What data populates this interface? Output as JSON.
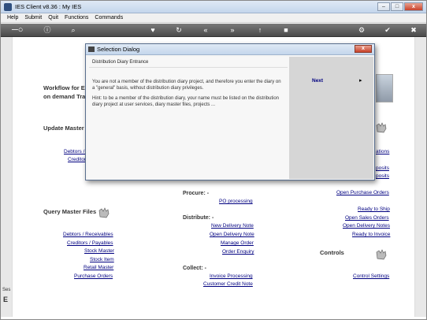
{
  "window": {
    "title": "IES Client v8.36 : My IES",
    "min": "–",
    "max": "□",
    "close": "x"
  },
  "menu": [
    "Help",
    "Submit",
    "Quit",
    "Functions",
    "Commands"
  ],
  "toolbar": {
    "icons": [
      "key-icon",
      "help-icon",
      "search-icon",
      "heart-icon",
      "refresh-icon",
      "back-icon",
      "forward-icon",
      "up-icon",
      "stop-icon",
      "settings-icon",
      "ok-icon",
      "close-icon"
    ]
  },
  "main": {
    "workflow_line1": "Workflow for Exp",
    "workflow_line2": "on demand Trad",
    "update_master": "Update Master Fi",
    "debtors_partial": "Debtors / I",
    "creditors_partial": "Creditor",
    "right_links_top": [
      "ations",
      "posits",
      "posits"
    ],
    "procure": "Procure: -",
    "po_processing": "PO processing",
    "open_purchase_orders": "Open Purchase Orders",
    "query_master": "Query Master Files",
    "distribute": "Distribute: -",
    "ready_to_ship": "Ready to Ship",
    "open_sales_orders": "Open Sales Orders",
    "open_delivery_notes": "Open Delivery Notes",
    "ready_to_invoice": "Ready to Invoice",
    "new_delivery_note": "New Delivery Note",
    "open_delivery_note": "Open Delivery Note",
    "manage_order": "Manage Order",
    "order_enquiry": "Order Enquiry",
    "controls": "Controls",
    "query_links": [
      "Debtors / Receivables",
      "Creditors / Payables",
      "Stock Master",
      "Stock Item",
      "Retail Master",
      "Purchase Orders"
    ],
    "collect": "Collect: -",
    "invoice_processing": "Invoice Processing",
    "customer_credit_note": "Customer Credit Note",
    "control_settings": "Control Settings",
    "bottom_left_1": "Ses",
    "bottom_left_2": "E"
  },
  "dialog": {
    "title": "Selection Dialog",
    "close": "x",
    "heading": "Distribution Diary Entrance",
    "para1": "You are not a member of the distribution diary project, and therefore you enter the diary on a \"general\" basis, without distribution diary privileges.",
    "para2": "Hint: to be a member of the distribution diary, your name must be listed on the distribution diary project at user services, diary master files, projects ...",
    "next": "Next",
    "arrow": "▸"
  }
}
